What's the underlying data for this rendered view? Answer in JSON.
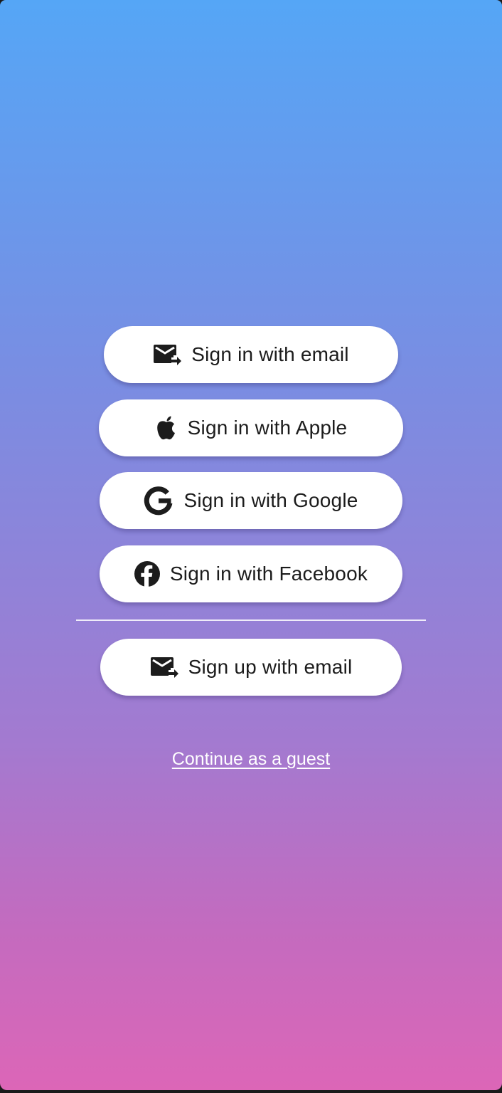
{
  "auth": {
    "email_signin_label": "Sign in with email",
    "apple_signin_label": "Sign in with Apple",
    "google_signin_label": "Sign in with Google",
    "facebook_signin_label": "Sign in with Facebook",
    "email_signup_label": "Sign up with email",
    "guest_link_label": "Continue as a guest"
  },
  "icons": {
    "email_signin": "forward-email-icon",
    "apple": "apple-icon",
    "google": "google-icon",
    "facebook": "facebook-icon",
    "email_signup": "forward-email-icon"
  },
  "colors": {
    "gradient_top": "#55a6f6",
    "gradient_bottom": "#dc66b7",
    "button_bg": "#ffffff",
    "button_text": "#1c1c1c",
    "link_text": "#ffffff"
  }
}
